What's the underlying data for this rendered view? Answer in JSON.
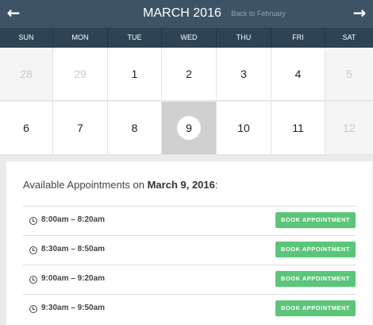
{
  "header": {
    "title": "MARCH 2016",
    "back_link": "Back to February",
    "prev_icon": "←",
    "next_icon": "→"
  },
  "weekdays": [
    "SUN",
    "MON",
    "TUE",
    "WED",
    "THU",
    "FRI",
    "SAT"
  ],
  "weeks": [
    [
      "28",
      "29",
      "1",
      "2",
      "3",
      "4",
      "5"
    ],
    [
      "6",
      "7",
      "8",
      "9",
      "10",
      "11",
      "12"
    ]
  ],
  "selected_day": "9",
  "appointments": {
    "title_prefix": "Available Appointments on ",
    "title_date": "March 9, 2016",
    "title_suffix": ":",
    "slots": [
      {
        "time": "8:00am – 8:20am",
        "button": "BOOK APPOINTMENT"
      },
      {
        "time": "8:30am – 8:50am",
        "button": "BOOK APPOINTMENT"
      },
      {
        "time": "9:00am – 9:20am",
        "button": "BOOK APPOINTMENT"
      },
      {
        "time": "9:30am – 9:50am",
        "button": "BOOK APPOINTMENT"
      }
    ]
  },
  "colors": {
    "header_bg": "#3e5466",
    "weekday_bg": "#2e4455",
    "book_button": "#5bc67a",
    "selected_day_bg": "#d0d0d0"
  }
}
